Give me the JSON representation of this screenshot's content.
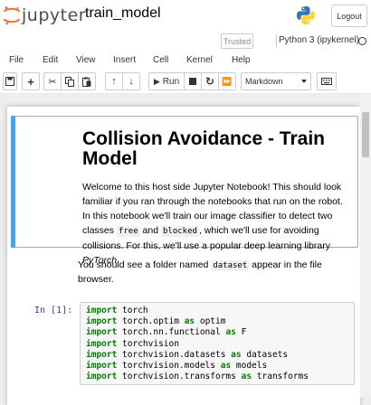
{
  "header": {
    "logo_text": "jupyter",
    "notebook_name": "train_model",
    "logout_label": "Logout"
  },
  "kernel": {
    "trusted_label": "Trusted",
    "kernel_name": "Python 3 (ipykernel)"
  },
  "menu": [
    "File",
    "Edit",
    "View",
    "Insert",
    "Cell",
    "Kernel",
    "Help"
  ],
  "toolbar": {
    "run_label": "Run",
    "cell_type": "Markdown"
  },
  "notebook": {
    "md_title": "Collision Avoidance - Train Model",
    "md_para_1": "Welcome to this host side Jupyter Notebook! This should look familiar if you ran through the notebooks that run on the robot. In this notebook we'll train our image classifier to detect two classes",
    "code_free": "free",
    "word_and": "and",
    "code_blocked": "blocked",
    "md_para_2": ", which we'll use for avoiding collisions. For this, we'll use a popular deep learning library",
    "lib_name": "PyTorch",
    "plain_1": "You should see a folder named",
    "code_dataset": "dataset",
    "plain_2": "appear in the file browser.",
    "prompt": "In [1]:",
    "code_lines": [
      {
        "kw": "import",
        "rest": " torch",
        "as": "",
        "alias": ""
      },
      {
        "kw": "import",
        "rest": " torch.optim ",
        "as": "as",
        "alias": " optim"
      },
      {
        "kw": "import",
        "rest": " torch.nn.functional ",
        "as": "as",
        "alias": " F"
      },
      {
        "kw": "import",
        "rest": " torchvision",
        "as": "",
        "alias": ""
      },
      {
        "kw": "import",
        "rest": " torchvision.datasets ",
        "as": "as",
        "alias": " datasets"
      },
      {
        "kw": "import",
        "rest": " torchvision.models ",
        "as": "as",
        "alias": " models"
      },
      {
        "kw": "import",
        "rest": " torchvision.transforms ",
        "as": "as",
        "alias": " transforms"
      }
    ]
  },
  "colors": {
    "selected_bar": "#42a5f5",
    "keyword": "#008000",
    "prompt": "#303f9f",
    "jupyter_orange": "#f37726"
  }
}
